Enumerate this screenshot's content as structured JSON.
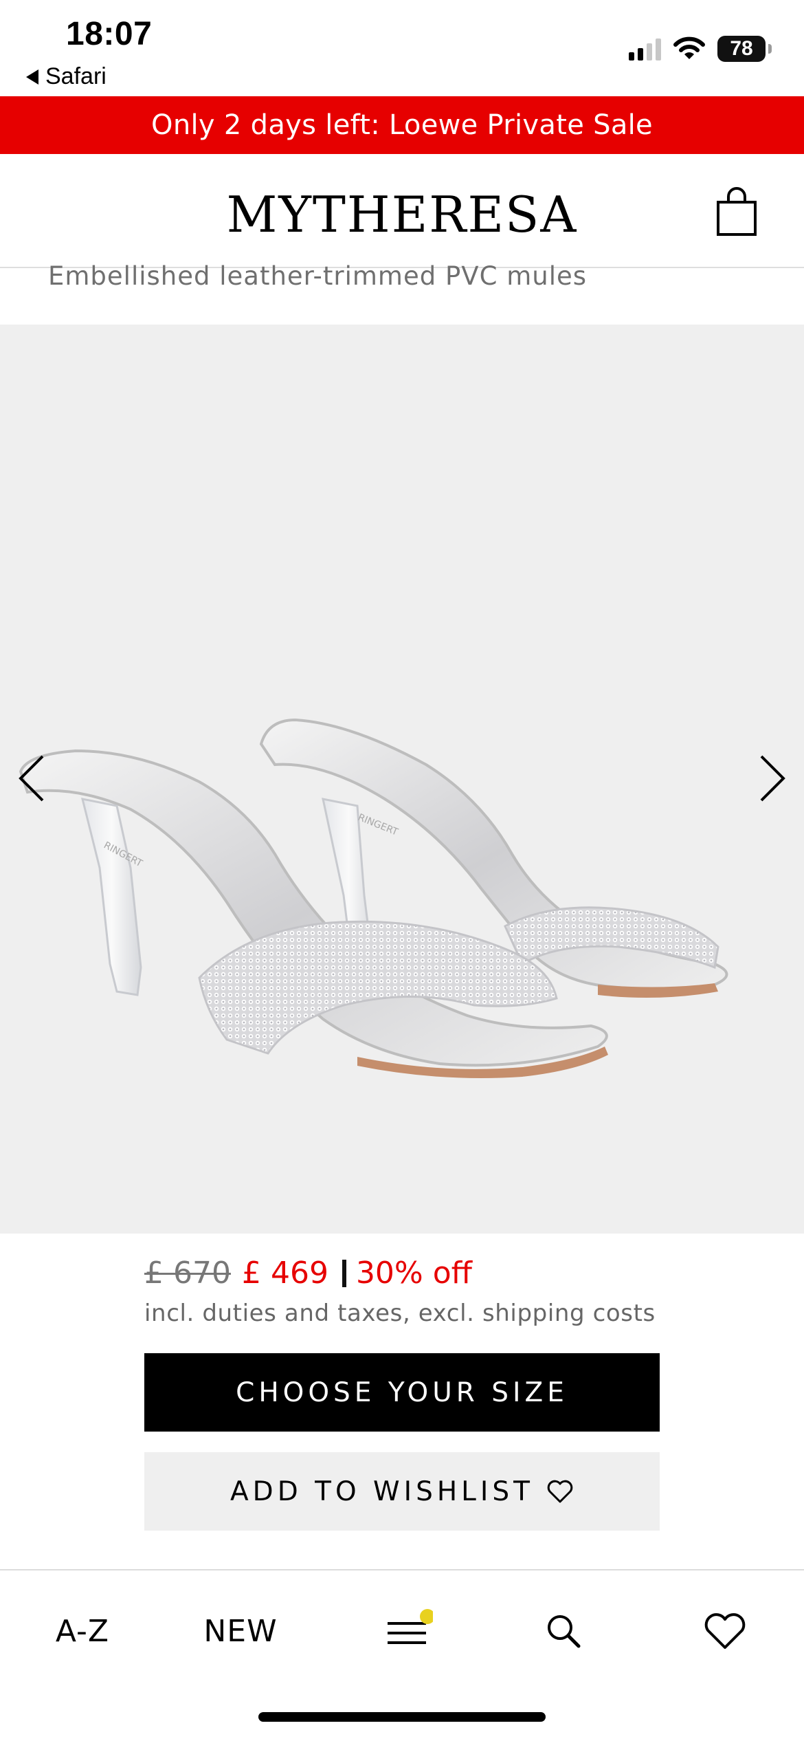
{
  "status_bar": {
    "time": "18:07",
    "back_label": "Safari",
    "battery": "78",
    "icons": [
      "signal-icon",
      "wifi-icon",
      "battery-icon"
    ]
  },
  "promo_banner": {
    "text": "Only 2 days left: Loewe Private Sale",
    "color": "#e60000"
  },
  "header": {
    "logo": "MYTHERESA",
    "cart_icon": "shopping-bag-icon"
  },
  "product": {
    "title": "Embellished leather-trimmed PVC mules",
    "price_original": "£ 670",
    "price_sale": "£ 469",
    "discount": "30% off",
    "tax_note": "incl. duties and taxes, excl. shipping costs"
  },
  "gallery": {
    "prev_icon": "chevron-left-icon",
    "next_icon": "chevron-right-icon"
  },
  "actions": {
    "choose_size": "CHOOSE YOUR SIZE",
    "add_to_wishlist": "ADD TO WISHLIST"
  },
  "bottom_nav": {
    "az": "A-Z",
    "new": "NEW",
    "menu_icon": "menu-icon",
    "search_icon": "search-icon",
    "wishlist_icon": "heart-icon"
  },
  "colors": {
    "accent": "#e60000",
    "primary_button": "#000000",
    "secondary_button": "#efefef",
    "notification_dot": "#e8d11f"
  }
}
